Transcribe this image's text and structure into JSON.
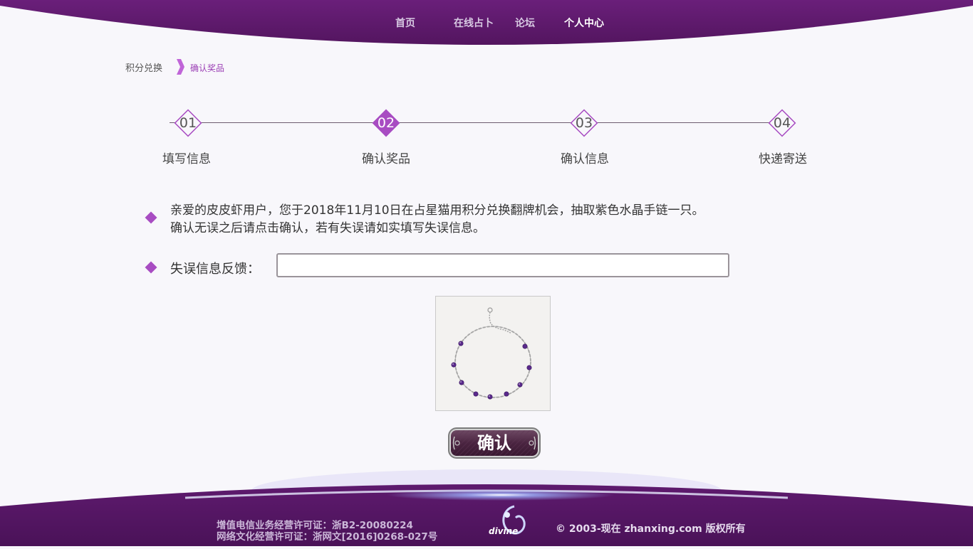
{
  "nav": {
    "items": [
      {
        "label": "首页"
      },
      {
        "label": "在线占卜"
      },
      {
        "label": "论坛"
      },
      {
        "label": "个人中心"
      }
    ],
    "active": "个人中心"
  },
  "breadcrumb": {
    "parent": "积分兑换",
    "current": "确认奖品"
  },
  "steps": [
    {
      "num": "01",
      "label": "填写信息"
    },
    {
      "num": "02",
      "label": "确认奖品"
    },
    {
      "num": "03",
      "label": "确认信息"
    },
    {
      "num": "04",
      "label": "快递寄送"
    }
  ],
  "active_step": "02",
  "message": {
    "line1": "亲爱的皮皮虾用户，您于2018年11月10日在占星猫用积分兑换翻牌机会，抽取紫色水晶手链一只。",
    "line2": "确认无误之后请点击确认，若有失误请如实填写失误信息。"
  },
  "feedback": {
    "label": "失误信息反馈：",
    "value": "",
    "placeholder": ""
  },
  "confirm_label": "确认",
  "footer": {
    "license1": "增值电信业务经营许可证：浙B2-20080224",
    "license2": "网络文化经营许可证：浙网文[2016]0268-027号",
    "copyright": "© 2003-现在 zhanxing.com 版权所有",
    "logo_text": "divine"
  },
  "colors": {
    "brand_purple": "#5f1a6e",
    "accent_purple": "#a84cc2",
    "background": "#f8f7fb"
  }
}
